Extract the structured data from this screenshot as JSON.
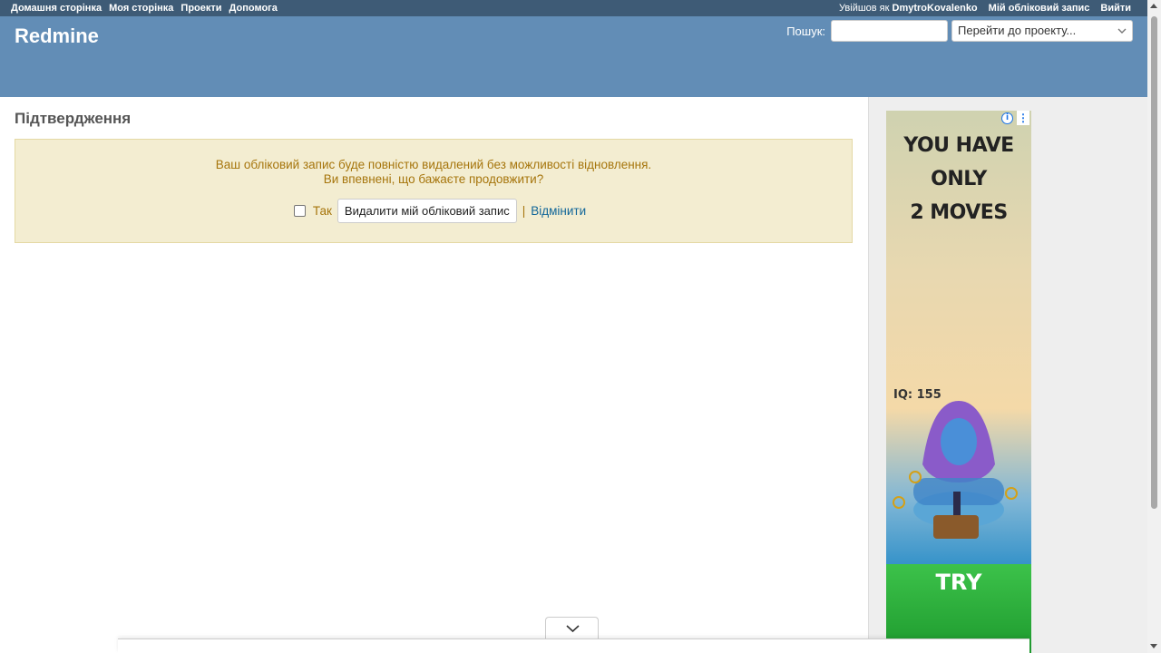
{
  "top_menu": {
    "items": [
      "Домашня сторінка",
      "Моя сторінка",
      "Проекти",
      "Допомога"
    ],
    "logged_as_prefix": "Увійшов як",
    "user": "DmytroKovalenko",
    "my_account": "Мій обліковий запис",
    "logout": "Вийти"
  },
  "header": {
    "title": "Redmine",
    "search_label": "Пошук:",
    "search_value": "",
    "jump_placeholder": "Перейти до проекту..."
  },
  "main": {
    "heading": "Підтвердження",
    "warning_line1": "Ваш обліковий запис буде повністю видалений без можливості відновлення.",
    "warning_line2": "Ви впевнені, що бажаєте продовжити?",
    "confirm_label": "Так",
    "delete_button": "Видалити мій обліковий запис",
    "separator": "|",
    "cancel_link": "Відмінити"
  },
  "ad": {
    "headline_line1": "YOU HAVE ONLY",
    "headline_line2": "2 MOVES",
    "iq_text": "IQ: 155",
    "cta": "TRY",
    "info_icon": "i",
    "more_icon": "⋮"
  },
  "colors": {
    "top_menu_bg": "#3E5B76",
    "header_bg": "#628DB6",
    "warning_bg": "#F3EDD1",
    "warning_text": "#A6750C",
    "link": "#169"
  }
}
